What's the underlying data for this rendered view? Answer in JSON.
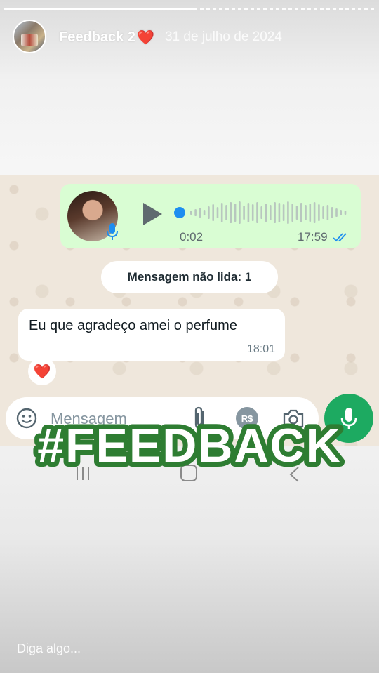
{
  "story": {
    "title": "Feedback 2",
    "title_emoji": "❤️",
    "date": "31 de julho de 2024",
    "progress": 0.52,
    "reply_placeholder": "Diga algo..."
  },
  "chat": {
    "voice_message": {
      "duration": "0:02",
      "time": "17:59",
      "status_icon": "double-check-read-icon"
    },
    "unread_banner": "Mensagem não lida: 1",
    "incoming": {
      "text": "Eu que agradeço amei o perfume",
      "time": "18:01",
      "reaction": "❤️"
    },
    "input": {
      "placeholder": "Mensagem",
      "currency_label": "R$"
    }
  },
  "sticker": {
    "text": "#FEEDBACK"
  },
  "colors": {
    "outgoing_bubble": "#d9fdd3",
    "accent_blue": "#1d8ef0",
    "whatsapp_green": "#1daa61",
    "sticker_green": "#2e7d32",
    "chat_background": "#efe7dc"
  }
}
